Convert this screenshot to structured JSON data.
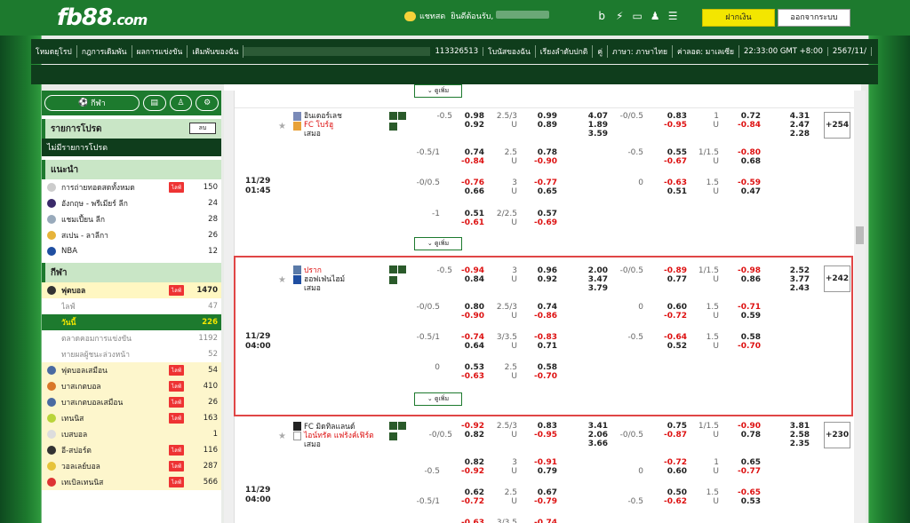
{
  "logo": {
    "main": "fb88",
    "suffix": ".com"
  },
  "topbar": {
    "chat": "แชทสด",
    "welcome": "ยินดีต้อนรับ,",
    "deposit": "ฝากเงิน",
    "logout": "ออกจากระบบ"
  },
  "menu": [
    "โหมดยุโรป",
    "กฎการเดิมพัน",
    "ผลการแข่งขัน",
    "เดิมพันของฉัน",
    "113326513",
    "โบนัสของฉัน",
    "เรียงลำดับปกติ",
    "คู่",
    "ภาษา: ภาษาไทย",
    "ค่าลอต: มาเลเซีย",
    "22:33:00 GMT +8:00",
    "2567/11/"
  ],
  "sidebar": {
    "tab_sports": "กีฬา",
    "my_list_title": "รายการโปรด",
    "my_list_btn": "ลบ",
    "my_list_empty": "ไม่มีรายการโปรด",
    "rec_title": "แนะนำ",
    "live_label": "ไลฟ์",
    "rec": [
      {
        "name": "การถ่ายทอดสดทั้งหมด",
        "count": "150"
      },
      {
        "name": "อังกฤษ - พรีเมียร์ ลีก",
        "count": "24"
      },
      {
        "name": "แชมเปี้ยน ลีก",
        "count": "28"
      },
      {
        "name": "สเปน - ลาลีกา",
        "count": "26"
      },
      {
        "name": "NBA",
        "count": "12"
      }
    ],
    "sports_title": "กีฬา",
    "sports": [
      {
        "name": "ฟุตบอล",
        "count": "1470"
      },
      {
        "name": "ไลฟ์",
        "count": "47"
      },
      {
        "name": "วันนี้",
        "count": "226"
      },
      {
        "name": "ตลาดคอมการแข่งขัน",
        "count": "1192"
      },
      {
        "name": "ทายผลผู้ชนะล่วงหน้า",
        "count": "52"
      },
      {
        "name": "ฟุตบอลเสมือน",
        "count": "54"
      },
      {
        "name": "บาสเกตบอล",
        "count": "410"
      },
      {
        "name": "บาสเกตบอลเสมือน",
        "count": "26"
      },
      {
        "name": "เทนนิส",
        "count": "163"
      },
      {
        "name": "เบสบอล",
        "count": "1"
      },
      {
        "name": "อี-สปอร์ต",
        "count": "116"
      },
      {
        "name": "วอลเลย์บอล",
        "count": "287"
      },
      {
        "name": "เทเบิลเทนนิส",
        "count": "566"
      }
    ]
  },
  "matches": {
    "more_label": "ดูเพิ่ม",
    "m1": {
      "home": "อินเดอร์เลช",
      "away": "FC โบร์ฮู",
      "draw": "เสมอ",
      "date": "11/29",
      "time": "01:45",
      "more": "+254",
      "rows": [
        [
          "-0.5",
          "0.98",
          "2.5/3",
          "0.99",
          "4.07",
          "-0/0.5",
          "0.83",
          "1",
          "0.72",
          "4.31"
        ],
        [
          "",
          "0.92",
          "U",
          "0.89",
          "1.89",
          "",
          "-0.95",
          "U",
          "-0.84",
          "2.47"
        ],
        [
          "",
          "",
          "",
          "",
          "3.59",
          "",
          "",
          "",
          "",
          "2.28"
        ]
      ],
      "sub": [
        [
          "-0.5/1",
          "0.74",
          "2.5",
          "0.78",
          "-0.5",
          "0.55",
          "1/1.5",
          "-0.80"
        ],
        [
          "",
          "-0.84",
          "U",
          "-0.90",
          "",
          "-0.67",
          "U",
          "0.68"
        ],
        [
          "-0/0.5",
          "-0.76",
          "3",
          "-0.77",
          "0",
          "-0.63",
          "1.5",
          "-0.59"
        ],
        [
          "",
          "0.66",
          "U",
          "0.65",
          "",
          "0.51",
          "U",
          "0.47"
        ],
        [
          "-1",
          "0.51",
          "2/2.5",
          "0.57",
          "",
          "",
          "",
          ""
        ],
        [
          "",
          "-0.61",
          "U",
          "-0.69",
          "",
          "",
          "",
          ""
        ]
      ]
    },
    "m2": {
      "home": "ปราก",
      "away": "ฮอฟเฟ่นไฮม์",
      "draw": "เสมอ",
      "date": "11/29",
      "time": "04:00",
      "more": "+242",
      "rows": [
        [
          "-0.5",
          "-0.94",
          "3",
          "0.96",
          "2.00",
          "-0/0.5",
          "-0.89",
          "1/1.5",
          "-0.98",
          "2.52"
        ],
        [
          "",
          "0.84",
          "U",
          "0.92",
          "3.47",
          "",
          "0.77",
          "U",
          "0.86",
          "3.77"
        ],
        [
          "",
          "",
          "",
          "",
          "3.79",
          "",
          "",
          "",
          "",
          "2.43"
        ]
      ],
      "sub": [
        [
          "-0/0.5",
          "0.80",
          "2.5/3",
          "0.74",
          "0",
          "0.60",
          "1.5",
          "-0.71"
        ],
        [
          "",
          "-0.90",
          "U",
          "-0.86",
          "",
          "-0.72",
          "U",
          "0.59"
        ],
        [
          "-0.5/1",
          "-0.74",
          "3/3.5",
          "-0.83",
          "-0.5",
          "-0.64",
          "1.5",
          "0.58"
        ],
        [
          "",
          "0.64",
          "U",
          "0.71",
          "",
          "0.52",
          "U",
          "-0.70"
        ],
        [
          "0",
          "0.53",
          "2.5",
          "0.58",
          "",
          "",
          "",
          ""
        ],
        [
          "",
          "-0.63",
          "U",
          "-0.70",
          "",
          "",
          "",
          ""
        ]
      ]
    },
    "m3": {
      "home": "FC มิดทิลแลนด์",
      "away": "ไอน์ทรัค แฟร้งค์เฟิร์ต",
      "draw": "เสมอ",
      "date": "11/29",
      "time": "04:00",
      "more": "+230",
      "rows": [
        [
          "",
          "-0.92",
          "2.5/3",
          "0.83",
          "3.41",
          "",
          "0.75",
          "1/1.5",
          "-0.90",
          "3.81"
        ],
        [
          "-0/0.5",
          "0.82",
          "U",
          "-0.95",
          "2.06",
          "-0/0.5",
          "-0.87",
          "U",
          "0.78",
          "2.58"
        ],
        [
          "",
          "",
          "",
          "",
          "3.66",
          "",
          "",
          "",
          "",
          "2.35"
        ]
      ],
      "sub": [
        [
          "",
          "0.82",
          "3",
          "-0.91",
          "",
          "-0.72",
          "1",
          "0.65"
        ],
        [
          "-0.5",
          "-0.92",
          "U",
          "0.79",
          "0",
          "0.60",
          "U",
          "-0.77"
        ],
        [
          "",
          "0.62",
          "2.5",
          "0.67",
          "",
          "0.50",
          "1.5",
          "-0.65"
        ],
        [
          "-0.5/1",
          "-0.72",
          "U",
          "-0.79",
          "-0.5",
          "-0.62",
          "U",
          "0.53"
        ],
        [
          "",
          "-0.63",
          "3/3.5",
          "-0.74",
          "",
          "",
          "",
          ""
        ]
      ]
    }
  }
}
